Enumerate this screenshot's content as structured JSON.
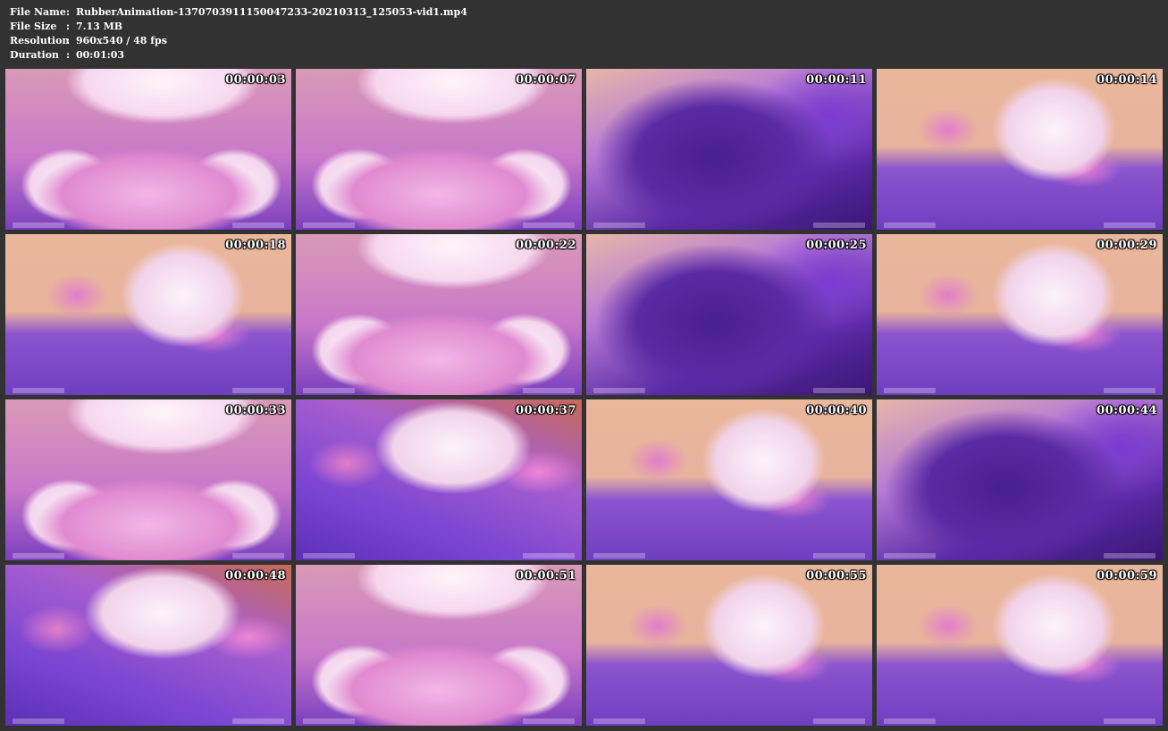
{
  "info": {
    "rows": [
      {
        "label": "File Name",
        "sep": ":",
        "value": "RubberAnimation-1370703911150047233-20210313_125053-vid1.mp4"
      },
      {
        "label": "File Size",
        "sep": ":",
        "value": "7.13 MB"
      },
      {
        "label": "Resolution",
        "sep": ":",
        "value": "960x540 / 48 fps"
      },
      {
        "label": "Duration",
        "sep": ":",
        "value": "00:01:03"
      }
    ]
  },
  "thumbnails": [
    {
      "timestamp": "00:00:03",
      "scene": "close"
    },
    {
      "timestamp": "00:00:07",
      "scene": "close"
    },
    {
      "timestamp": "00:00:11",
      "scene": "blur"
    },
    {
      "timestamp": "00:00:14",
      "scene": "wide"
    },
    {
      "timestamp": "00:00:18",
      "scene": "wide"
    },
    {
      "timestamp": "00:00:22",
      "scene": "close"
    },
    {
      "timestamp": "00:00:25",
      "scene": "blur"
    },
    {
      "timestamp": "00:00:29",
      "scene": "wide"
    },
    {
      "timestamp": "00:00:33",
      "scene": "close"
    },
    {
      "timestamp": "00:00:37",
      "scene": "angle"
    },
    {
      "timestamp": "00:00:40",
      "scene": "wide"
    },
    {
      "timestamp": "00:00:44",
      "scene": "blur"
    },
    {
      "timestamp": "00:00:48",
      "scene": "angle"
    },
    {
      "timestamp": "00:00:51",
      "scene": "close"
    },
    {
      "timestamp": "00:00:55",
      "scene": "wide"
    },
    {
      "timestamp": "00:00:59",
      "scene": "wide"
    }
  ],
  "colors": {
    "background": "#323232",
    "text": "#ffffff"
  }
}
